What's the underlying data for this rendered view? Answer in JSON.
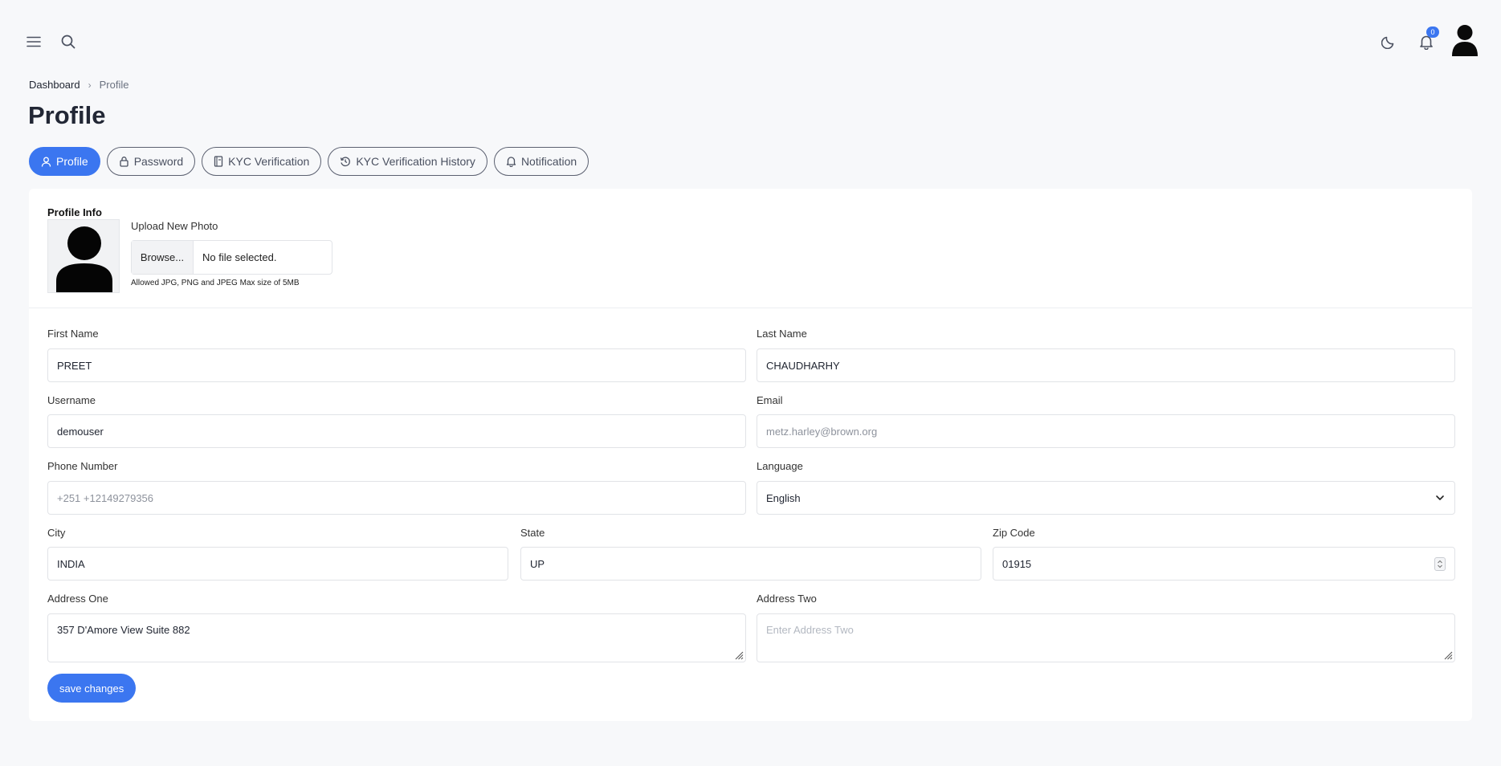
{
  "topbar": {
    "notification_count": "0"
  },
  "breadcrumb": {
    "home": "Dashboard",
    "separator": "›",
    "current": "Profile"
  },
  "page_title": "Profile",
  "tabs": [
    {
      "label": "Profile",
      "icon": "user-icon",
      "active": true
    },
    {
      "label": "Password",
      "icon": "lock-icon",
      "active": false
    },
    {
      "label": "KYC Verification",
      "icon": "document-icon",
      "active": false
    },
    {
      "label": "KYC Verification History",
      "icon": "history-icon",
      "active": false
    },
    {
      "label": "Notification",
      "icon": "bell-icon",
      "active": false
    }
  ],
  "profile_info": {
    "title": "Profile Info",
    "upload_label": "Upload New Photo",
    "browse_label": "Browse...",
    "file_status": "No file selected.",
    "hint": "Allowed JPG, PNG and JPEG Max size of 5MB"
  },
  "form": {
    "first_name": {
      "label": "First Name",
      "value": "PREET"
    },
    "last_name": {
      "label": "Last Name",
      "value": "CHAUDHARHY"
    },
    "username": {
      "label": "Username",
      "value": "demouser"
    },
    "email": {
      "label": "Email",
      "value": "metz.harley@brown.org"
    },
    "phone": {
      "label": "Phone Number",
      "value": "+251 +12149279356"
    },
    "language": {
      "label": "Language",
      "value": "English"
    },
    "city": {
      "label": "City",
      "value": "INDIA"
    },
    "state": {
      "label": "State",
      "value": "UP"
    },
    "zip": {
      "label": "Zip Code",
      "value": "01915"
    },
    "address_one": {
      "label": "Address One",
      "value": "357 D'Amore View Suite 882"
    },
    "address_two": {
      "label": "Address Two",
      "placeholder": "Enter Address Two"
    }
  },
  "save_label": "save changes",
  "colors": {
    "accent": "#3b76f0",
    "background": "#f7f8fa",
    "card": "#ffffff"
  }
}
